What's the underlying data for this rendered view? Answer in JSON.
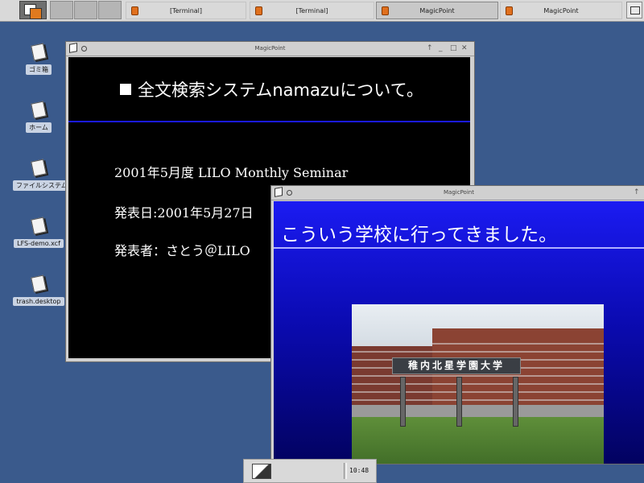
{
  "taskbar": {
    "tasks": [
      {
        "label": "[Terminal]",
        "active": false
      },
      {
        "label": "[Terminal]",
        "active": false
      },
      {
        "label": "MagicPoint",
        "active": true
      },
      {
        "label": "MagicPoint",
        "active": false
      }
    ]
  },
  "desktop_icons": [
    {
      "label": "ゴミ箱",
      "icon": "trash-icon"
    },
    {
      "label": "ホーム",
      "icon": "home-icon"
    },
    {
      "label": "ファイルシステム",
      "icon": "filesystem-icon"
    },
    {
      "label": "LFS-demo.xcf",
      "icon": "file-icon"
    },
    {
      "label": "trash.desktop",
      "icon": "file-icon"
    }
  ],
  "window1": {
    "title": "MagicPoint",
    "slide": {
      "heading": "全文検索システムnamazuについて。",
      "lines": [
        "2001年5月度 LILO Monthly Seminar",
        "発表日:2001年5月27日",
        "発表者：さとう＠LILO"
      ]
    }
  },
  "window2": {
    "title": "MagicPoint",
    "slide": {
      "heading": "こういう学校に行ってきました。",
      "photo_sign": "稚内北星学園大学"
    }
  },
  "bottom_panel": {
    "clock": "10:48"
  },
  "colors": {
    "desktop": "#3a5a8c",
    "slide_rule_window1": "#1a1aee",
    "slide_bg_window2_top": "#1b1bf2"
  }
}
